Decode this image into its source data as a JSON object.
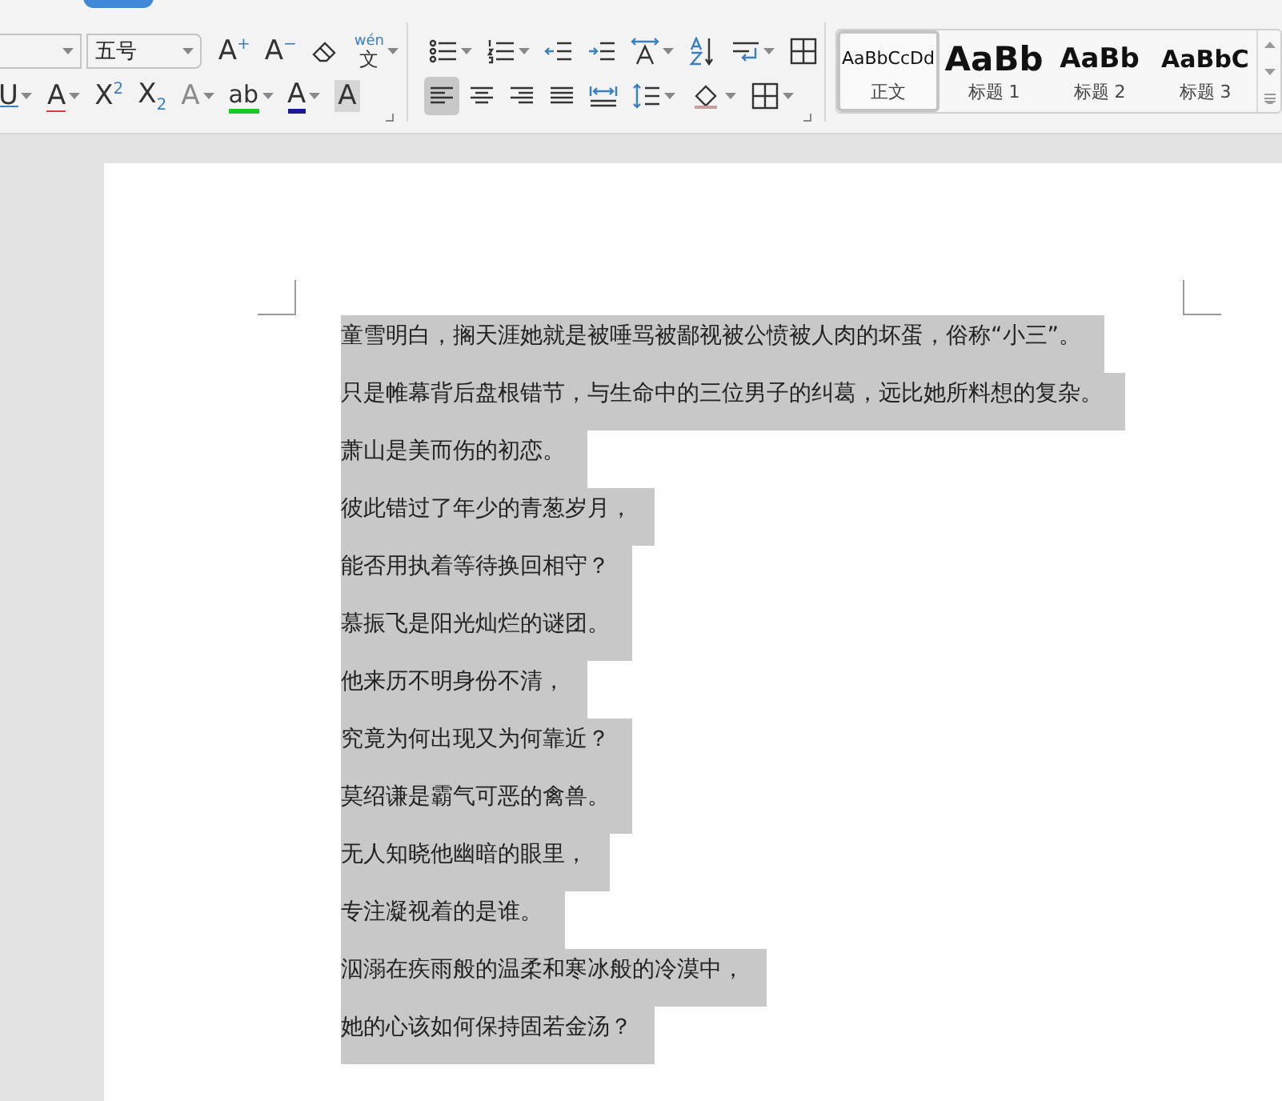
{
  "ribbon": {
    "font_group": {
      "font_size": {
        "value": "五号"
      },
      "row1": [
        {
          "kind": "glyph",
          "text": "A$^{+}$",
          "dropdown": false
        },
        {
          "kind": "glyph",
          "text": "A$^{−}$",
          "dropdown": false
        },
        {
          "kind": "eraser",
          "dropdown": false
        },
        {
          "kind": "phonetic",
          "pinyin": "wén",
          "text": "文",
          "dropdown": true
        }
      ],
      "row2": [
        {
          "kind": "underline",
          "text": "U",
          "dropdown": true
        },
        {
          "kind": "strike",
          "text": "A",
          "dropdown": true
        },
        {
          "kind": "glyph",
          "text": "X$^{2}$",
          "dropdown": false
        },
        {
          "kind": "glyph",
          "text": "X$_{2}$",
          "dropdown": false
        },
        {
          "kind": "effect",
          "text": "A",
          "dropdown": true
        },
        {
          "kind": "highlight",
          "text": "ab",
          "dropdown": true
        },
        {
          "kind": "fontcolor",
          "text": "A",
          "dropdown": true
        },
        {
          "kind": "shading",
          "text": "A",
          "dropdown": false
        }
      ]
    },
    "paragraph_group": {
      "row1": [
        {
          "kind": "bullets",
          "dropdown": true
        },
        {
          "kind": "numbering",
          "dropdown": true
        },
        {
          "kind": "outdent",
          "dropdown": false
        },
        {
          "kind": "indent",
          "dropdown": false
        },
        {
          "kind": "direction",
          "dropdown": true
        },
        {
          "kind": "sort",
          "dropdown": false
        },
        {
          "kind": "wrap",
          "dropdown": true
        },
        {
          "kind": "table",
          "dropdown": false
        }
      ],
      "alignment": [
        {
          "kind": "left",
          "selected": true
        },
        {
          "kind": "center",
          "selected": false
        },
        {
          "kind": "right",
          "selected": false
        },
        {
          "kind": "justify",
          "selected": false
        },
        {
          "kind": "distribute",
          "selected": false
        }
      ],
      "row2": [
        {
          "kind": "spacing",
          "dropdown": true
        },
        {
          "kind": "fill",
          "dropdown": true
        },
        {
          "kind": "border",
          "dropdown": true
        }
      ]
    },
    "styles": [
      {
        "preview": "AaBbCcDd",
        "label": "正文",
        "kind": "body",
        "selected": true
      },
      {
        "preview": "AaBb",
        "label": "标题 1",
        "kind": "h1",
        "selected": false
      },
      {
        "preview": "AaBb",
        "label": "标题 2",
        "kind": "h2",
        "selected": false
      },
      {
        "preview": "AaBbC",
        "label": "标题 3",
        "kind": "h3",
        "selected": false
      }
    ]
  },
  "document": {
    "paragraphs": [
      {
        "text": "童雪明白，搁天涯她就是被唾骂被鄙视被公愤被人肉的坏蛋，俗称“小三”。",
        "selected": true
      },
      {
        "text": "只是帷幕背后盘根错节，与生命中的三位男子的纠葛，远比她所料想的复杂。",
        "selected": true
      },
      {
        "text": "萧山是美而伤的初恋。",
        "selected": true
      },
      {
        "text": "彼此错过了年少的青葱岁月，",
        "selected": true
      },
      {
        "text": "能否用执着等待换回相守？",
        "selected": true
      },
      {
        "text": "慕振飞是阳光灿烂的谜团。",
        "selected": true
      },
      {
        "text": "他来历不明身份不清，",
        "selected": true
      },
      {
        "text": "究竟为何出现又为何靠近？",
        "selected": true
      },
      {
        "text": "莫绍谦是霸气可恶的禽兽。",
        "selected": true
      },
      {
        "text": "无人知晓他幽暗的眼里，",
        "selected": true
      },
      {
        "text": "专注凝视着的是谁。",
        "selected": true
      },
      {
        "text": "泅溺在疾雨般的温柔和寒冰般的冷漠中，",
        "selected": true
      },
      {
        "text": "她的心该如何保持固若金汤？",
        "selected": true
      }
    ]
  }
}
